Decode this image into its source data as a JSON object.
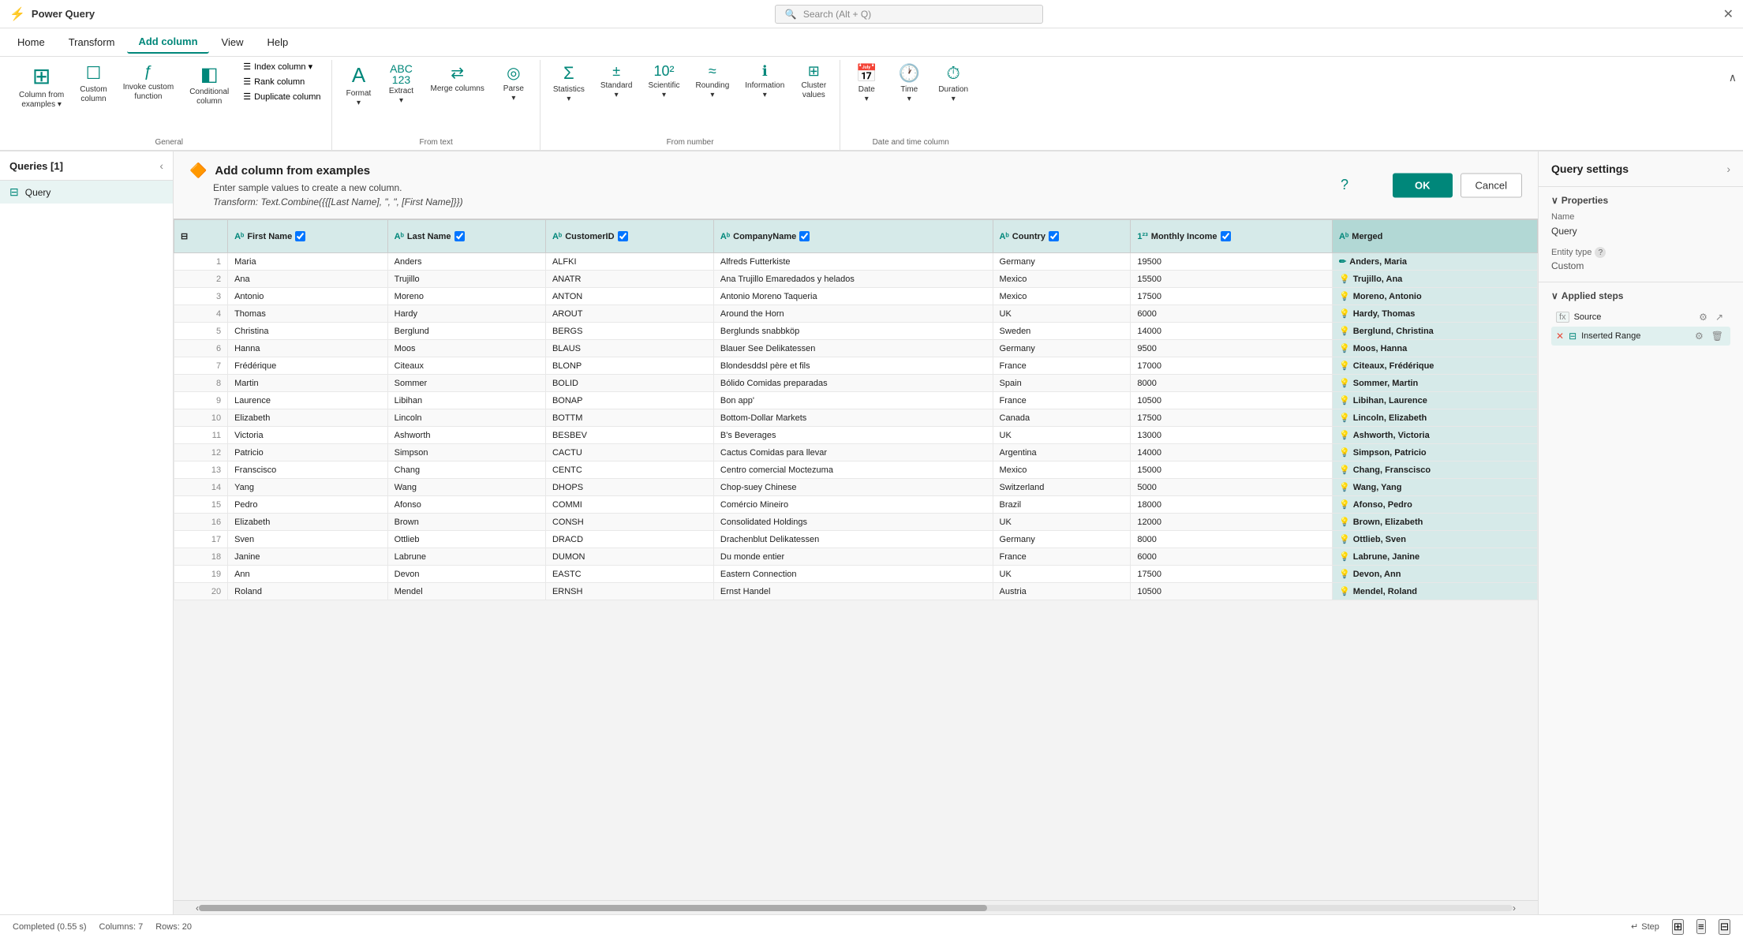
{
  "app": {
    "title": "Power Query",
    "close_label": "✕"
  },
  "search": {
    "placeholder": "Search (Alt + Q)"
  },
  "menubar": {
    "items": [
      {
        "label": "Home",
        "active": false
      },
      {
        "label": "Transform",
        "active": false
      },
      {
        "label": "Add column",
        "active": true
      },
      {
        "label": "View",
        "active": false
      },
      {
        "label": "Help",
        "active": false
      }
    ]
  },
  "ribbon": {
    "groups": [
      {
        "label": "General",
        "buttons": [
          {
            "icon": "⊞",
            "label": "Column from\nexamples ▾",
            "name": "column-from-examples"
          },
          {
            "icon": "☐",
            "label": "Custom\ncolumn",
            "name": "custom-column"
          },
          {
            "icon": "ƒ",
            "label": "Invoke custom\nfunction",
            "name": "invoke-custom-function"
          },
          {
            "icon": "◧",
            "label": "Conditional\ncolumn",
            "name": "conditional-column"
          }
        ],
        "small_buttons": [
          {
            "label": "Index column ▾",
            "name": "index-column"
          },
          {
            "label": "Rank column",
            "name": "rank-column"
          },
          {
            "label": "Duplicate column",
            "name": "duplicate-column"
          }
        ]
      },
      {
        "label": "From text",
        "buttons": [
          {
            "icon": "A",
            "label": "Format\n▾",
            "name": "format"
          },
          {
            "icon": "ABC\n123",
            "label": "Extract\n▾",
            "name": "extract"
          },
          {
            "icon": "◎",
            "label": "Parse\n▾",
            "name": "parse"
          },
          {
            "icon": "⊞⊟",
            "label": "Merge columns",
            "name": "merge-columns"
          }
        ]
      },
      {
        "label": "From number",
        "buttons": [
          {
            "icon": "Σ",
            "label": "Statistics\n▾",
            "name": "statistics"
          },
          {
            "icon": "±",
            "label": "Standard\n▾",
            "name": "standard"
          },
          {
            "icon": "10²",
            "label": "Scientific\n▾",
            "name": "scientific"
          },
          {
            "icon": "~",
            "label": "Rounding\n▾",
            "name": "rounding"
          },
          {
            "icon": "∑",
            "label": "Information\n▾",
            "name": "information"
          },
          {
            "icon": "⊞",
            "label": "Cluster\nvalues",
            "name": "cluster-values"
          }
        ]
      },
      {
        "label": "Date and time column",
        "buttons": [
          {
            "icon": "📅",
            "label": "Date\n▾",
            "name": "date"
          },
          {
            "icon": "🕐",
            "label": "Time\n▾",
            "name": "time"
          },
          {
            "icon": "⏱",
            "label": "Duration\n▾",
            "name": "duration"
          }
        ]
      }
    ]
  },
  "queries_panel": {
    "title": "Queries [1]",
    "items": [
      {
        "label": "Query",
        "icon": "table",
        "active": true
      }
    ]
  },
  "add_column_panel": {
    "icon": "🔶",
    "title": "Add column from examples",
    "subtitle": "Enter sample values to create a new column.",
    "formula": "Transform: Text.Combine({{[Last Name], \", \", [First Name]}})",
    "ok_label": "OK",
    "cancel_label": "Cancel"
  },
  "table": {
    "columns": [
      {
        "label": "First Name",
        "type": "Aᵇ",
        "name": "first-name"
      },
      {
        "label": "Last Name",
        "type": "Aᵇ",
        "name": "last-name"
      },
      {
        "label": "CustomerID",
        "type": "Aᵇ",
        "name": "customer-id"
      },
      {
        "label": "CompanyName",
        "type": "Aᵇ",
        "name": "company-name"
      },
      {
        "label": "Country",
        "type": "Aᵇ",
        "name": "country"
      },
      {
        "label": "Monthly Income",
        "type": "1²³",
        "name": "monthly-income"
      },
      {
        "label": "Merged",
        "type": "Aᵇ",
        "name": "merged",
        "special": true
      }
    ],
    "rows": [
      [
        1,
        "Maria",
        "Anders",
        "ALFKI",
        "Alfreds Futterkiste",
        "Germany",
        "19500",
        "Anders, Maria"
      ],
      [
        2,
        "Ana",
        "Trujillo",
        "ANATR",
        "Ana Trujillo Emaredados y helados",
        "Mexico",
        "15500",
        "Trujillo, Ana"
      ],
      [
        3,
        "Antonio",
        "Moreno",
        "ANTON",
        "Antonio Moreno Taqueria",
        "Mexico",
        "17500",
        "Moreno, Antonio"
      ],
      [
        4,
        "Thomas",
        "Hardy",
        "AROUT",
        "Around the Horn",
        "UK",
        "6000",
        "Hardy, Thomas"
      ],
      [
        5,
        "Christina",
        "Berglund",
        "BERGS",
        "Berglunds snabbköp",
        "Sweden",
        "14000",
        "Berglund, Christina"
      ],
      [
        6,
        "Hanna",
        "Moos",
        "BLAUS",
        "Blauer See Delikatessen",
        "Germany",
        "9500",
        "Moos, Hanna"
      ],
      [
        7,
        "Frédérique",
        "Citeaux",
        "BLONP",
        "Blondesddsl père et fils",
        "France",
        "17000",
        "Citeaux, Frédérique"
      ],
      [
        8,
        "Martin",
        "Sommer",
        "BOLID",
        "Bólido Comidas preparadas",
        "Spain",
        "8000",
        "Sommer, Martin"
      ],
      [
        9,
        "Laurence",
        "Libihan",
        "BONAP",
        "Bon app'",
        "France",
        "10500",
        "Libihan, Laurence"
      ],
      [
        10,
        "Elizabeth",
        "Lincoln",
        "BOTTM",
        "Bottom-Dollar Markets",
        "Canada",
        "17500",
        "Lincoln, Elizabeth"
      ],
      [
        11,
        "Victoria",
        "Ashworth",
        "BESBEV",
        "B's Beverages",
        "UK",
        "13000",
        "Ashworth, Victoria"
      ],
      [
        12,
        "Patricio",
        "Simpson",
        "CACTU",
        "Cactus Comidas para llevar",
        "Argentina",
        "14000",
        "Simpson, Patricio"
      ],
      [
        13,
        "Franscisco",
        "Chang",
        "CENTC",
        "Centro comercial Moctezuma",
        "Mexico",
        "15000",
        "Chang, Franscisco"
      ],
      [
        14,
        "Yang",
        "Wang",
        "DHOPS",
        "Chop-suey Chinese",
        "Switzerland",
        "5000",
        "Wang, Yang"
      ],
      [
        15,
        "Pedro",
        "Afonso",
        "COMMI",
        "Comércio Mineiro",
        "Brazil",
        "18000",
        "Afonso, Pedro"
      ],
      [
        16,
        "Elizabeth",
        "Brown",
        "CONSH",
        "Consolidated Holdings",
        "UK",
        "12000",
        "Brown, Elizabeth"
      ],
      [
        17,
        "Sven",
        "Ottlieb",
        "DRACD",
        "Drachenblut Delikatessen",
        "Germany",
        "8000",
        "Ottlieb, Sven"
      ],
      [
        18,
        "Janine",
        "Labrune",
        "DUMON",
        "Du monde entier",
        "France",
        "6000",
        "Labrune, Janine"
      ],
      [
        19,
        "Ann",
        "Devon",
        "EASTC",
        "Eastern Connection",
        "UK",
        "17500",
        "Devon, Ann"
      ],
      [
        20,
        "Roland",
        "Mendel",
        "ERNSH",
        "Ernst Handel",
        "Austria",
        "10500",
        "Mendel, Roland"
      ]
    ]
  },
  "right_panel": {
    "title": "Query settings",
    "chevron": "›",
    "properties_label": "Properties",
    "name_label": "Name",
    "name_value": "Query",
    "entity_type_label": "Entity type",
    "entity_type_help": "?",
    "entity_type_value": "Custom",
    "applied_steps_label": "Applied steps",
    "steps": [
      {
        "label": "Source",
        "has_fx": true,
        "has_gear": true,
        "has_delete": false,
        "active": false
      },
      {
        "label": "Inserted Range",
        "has_fx": false,
        "has_gear": true,
        "has_delete": true,
        "active": true
      }
    ]
  },
  "statusbar": {
    "status": "Completed (0.55 s)",
    "columns": "Columns: 7",
    "rows": "Rows: 20",
    "step_label": "Step",
    "view_icons": [
      "⊞",
      "≡",
      "⊟"
    ]
  }
}
